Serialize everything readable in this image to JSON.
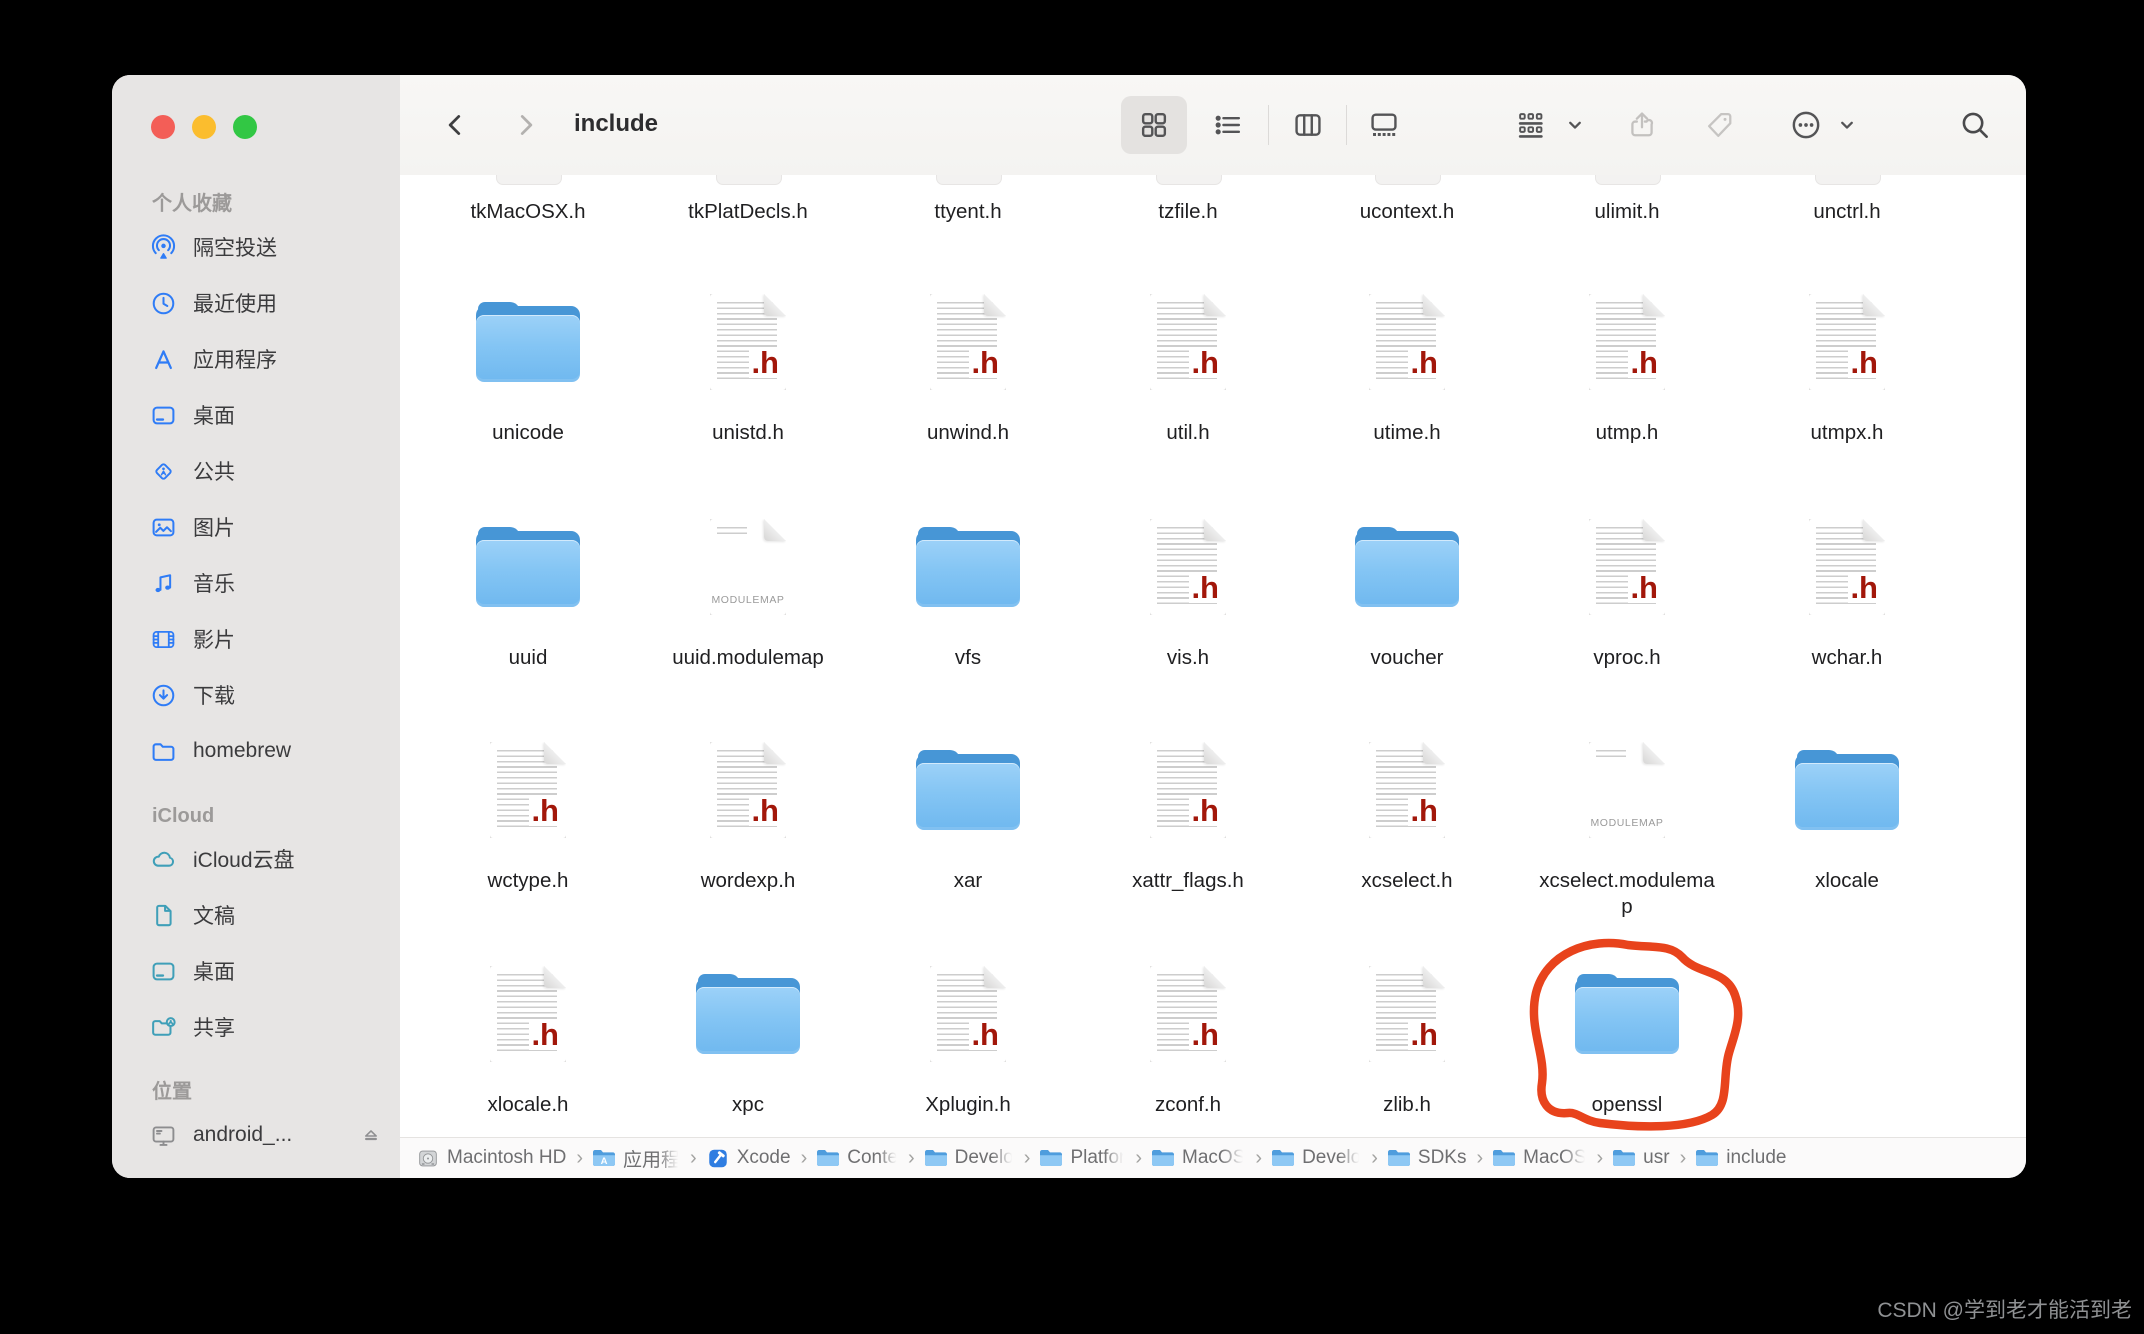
{
  "colors": {
    "favorites_accent": "#2f7cf6",
    "icloud_accent": "#3f9fb8",
    "locations_accent": "#8d8d8f",
    "folder_blue_front": "#84c5f4",
    "folder_blue_back": "#4796d6",
    "header_ext_red": "#a2170a",
    "annotation_red": "#e8431c",
    "traffic_red": "#f35e57",
    "traffic_yellow": "#fbbd2e",
    "traffic_green": "#32c744"
  },
  "window": {
    "toolbar": {
      "title": "include",
      "back": "back",
      "forward": "forward",
      "views": [
        "icons",
        "list",
        "columns",
        "gallery"
      ],
      "selected_view": "icons",
      "actions": [
        "group",
        "share",
        "tag",
        "more",
        "search"
      ]
    },
    "sidebar": {
      "sections": [
        {
          "label": "个人收藏",
          "accent": "#2f7cf6",
          "items": [
            {
              "label": "隔空投送",
              "icon": "airdrop"
            },
            {
              "label": "最近使用",
              "icon": "clock"
            },
            {
              "label": "应用程序",
              "icon": "appstore"
            },
            {
              "label": "桌面",
              "icon": "desktop"
            },
            {
              "label": "公共",
              "icon": "public"
            },
            {
              "label": "图片",
              "icon": "pictures"
            },
            {
              "label": "音乐",
              "icon": "music"
            },
            {
              "label": "影片",
              "icon": "movies"
            },
            {
              "label": "下载",
              "icon": "downloads"
            },
            {
              "label": "homebrew",
              "icon": "folder"
            }
          ]
        },
        {
          "label": "iCloud",
          "accent": "#3f9fb8",
          "items": [
            {
              "label": "iCloud云盘",
              "icon": "icloud"
            },
            {
              "label": "文稿",
              "icon": "doc"
            },
            {
              "label": "桌面",
              "icon": "desktop"
            },
            {
              "label": "共享",
              "icon": "shared"
            }
          ]
        },
        {
          "label": "位置",
          "accent": "#8d8d8f",
          "items": [
            {
              "label": "android_...",
              "icon": "display",
              "eject": true
            }
          ]
        }
      ]
    },
    "grid": {
      "rows": [
        [
          {
            "name": "tkMacOSX.h",
            "kind": "label-only"
          },
          {
            "name": "tkPlatDecls.h",
            "kind": "label-only"
          },
          {
            "name": "ttyent.h",
            "kind": "label-only"
          },
          {
            "name": "tzfile.h",
            "kind": "label-only"
          },
          {
            "name": "ucontext.h",
            "kind": "label-only"
          },
          {
            "name": "ulimit.h",
            "kind": "label-only"
          },
          {
            "name": "unctrl.h",
            "kind": "label-only"
          }
        ],
        [
          {
            "name": "unicode",
            "kind": "folder"
          },
          {
            "name": "unistd.h",
            "kind": "header"
          },
          {
            "name": "unwind.h",
            "kind": "header"
          },
          {
            "name": "util.h",
            "kind": "header"
          },
          {
            "name": "utime.h",
            "kind": "header"
          },
          {
            "name": "utmp.h",
            "kind": "header"
          },
          {
            "name": "utmpx.h",
            "kind": "header"
          }
        ],
        [
          {
            "name": "uuid",
            "kind": "folder"
          },
          {
            "name": "uuid.modulemap",
            "kind": "modulemap"
          },
          {
            "name": "vfs",
            "kind": "folder"
          },
          {
            "name": "vis.h",
            "kind": "header"
          },
          {
            "name": "voucher",
            "kind": "folder"
          },
          {
            "name": "vproc.h",
            "kind": "header"
          },
          {
            "name": "wchar.h",
            "kind": "header"
          }
        ],
        [
          {
            "name": "wctype.h",
            "kind": "header"
          },
          {
            "name": "wordexp.h",
            "kind": "header"
          },
          {
            "name": "xar",
            "kind": "folder"
          },
          {
            "name": "xattr_flags.h",
            "kind": "header"
          },
          {
            "name": "xcselect.h",
            "kind": "header"
          },
          {
            "name": "xcselect.modulemap",
            "kind": "modulemap"
          },
          {
            "name": "xlocale",
            "kind": "folder"
          }
        ],
        [
          {
            "name": "xlocale.h",
            "kind": "header"
          },
          {
            "name": "xpc",
            "kind": "folder"
          },
          {
            "name": "Xplugin.h",
            "kind": "header"
          },
          {
            "name": "zconf.h",
            "kind": "header"
          },
          {
            "name": "zlib.h",
            "kind": "header"
          },
          {
            "name": "openssl",
            "kind": "folder",
            "circled": true
          }
        ]
      ],
      "modulemap_badge": "MODULEMAP",
      "header_ext": ".h"
    },
    "annotation": {
      "type": "hand-drawn-circle",
      "around": "openssl",
      "color": "#e8431c"
    },
    "breadcrumbs": [
      {
        "label": "Macintosh HD",
        "icon": "drive"
      },
      {
        "label": "应用程",
        "icon": "folder-apps",
        "truncated": true
      },
      {
        "label": "Xcode",
        "icon": "xcode"
      },
      {
        "label": "Conte",
        "icon": "folder",
        "truncated": true
      },
      {
        "label": "Develo",
        "icon": "folder",
        "truncated": true
      },
      {
        "label": "Platfor",
        "icon": "folder",
        "truncated": true
      },
      {
        "label": "MacOS",
        "icon": "folder",
        "truncated": true
      },
      {
        "label": "Develo",
        "icon": "folder",
        "truncated": true
      },
      {
        "label": "SDKs",
        "icon": "folder"
      },
      {
        "label": "MacOS",
        "icon": "folder",
        "truncated": true
      },
      {
        "label": "usr",
        "icon": "folder"
      },
      {
        "label": "include",
        "icon": "folder"
      }
    ]
  },
  "watermark": "CSDN @学到老才能活到老"
}
